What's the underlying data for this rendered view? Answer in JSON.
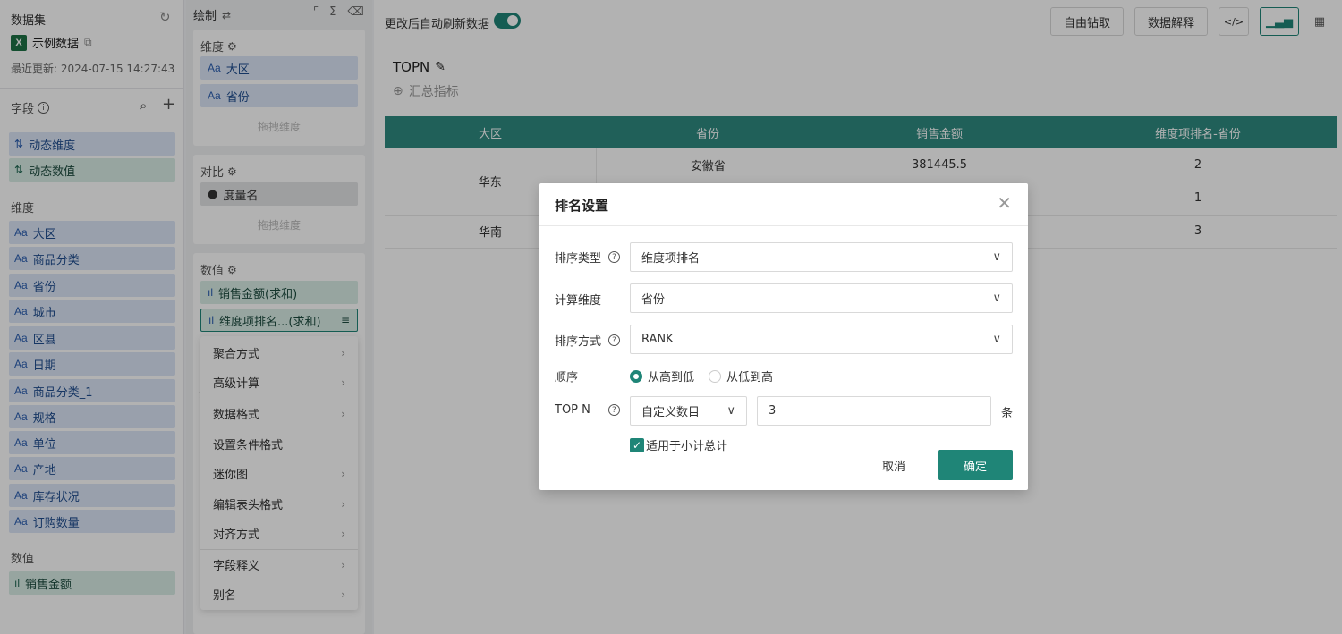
{
  "left": {
    "dataset_title": "数据集",
    "dataset_name": "示例数据",
    "last_update": "最近更新: 2024-07-15 14:27:43",
    "fields_label": "字段",
    "dynamic": [
      "动态维度",
      "动态数值"
    ],
    "dimensions_label": "维度",
    "dimensions": [
      "大区",
      "商品分类",
      "省份",
      "城市",
      "区县",
      "日期",
      "商品分类_1",
      "规格",
      "单位",
      "产地",
      "库存状况",
      "订购数量"
    ],
    "measures_label": "数值",
    "measures": [
      "销售金额"
    ]
  },
  "mid": {
    "draw_label": "绘制",
    "dim_label": "维度",
    "dim_pills": [
      "大区",
      "省份"
    ],
    "dim_hint": "拖拽维度",
    "compare_label": "对比",
    "compare_pill": "度量名",
    "compare_hint": "拖拽维度",
    "value_label": "数值",
    "value_pills": [
      "销售金额(求和)",
      "维度项排名...(求和)"
    ],
    "fen_peek": "分"
  },
  "menu": {
    "items": [
      "聚合方式",
      "高级计算",
      "数据格式",
      "设置条件格式",
      "迷你图",
      "编辑表头格式",
      "对齐方式",
      "字段释义",
      "别名"
    ]
  },
  "main": {
    "auto_refresh": "更改后自动刷新数据",
    "btn_drill": "自由钻取",
    "btn_explain": "数据解释",
    "code_icon": "</>",
    "title": "TOPN",
    "add_metric": "汇总指标",
    "table": {
      "headers": [
        "大区",
        "省份",
        "销售金额",
        "维度项排名-省份"
      ],
      "rows": [
        {
          "region": "华东",
          "province": "安徽省",
          "amount": "381445.5",
          "rank": "2"
        },
        {
          "region": "",
          "province": "",
          "amount": "",
          "rank": "1"
        },
        {
          "region": "华南",
          "province": "",
          "amount": "",
          "rank": "3"
        }
      ]
    }
  },
  "modal": {
    "title": "排名设置",
    "sort_type_label": "排序类型",
    "sort_type_value": "维度项排名",
    "calc_dim_label": "计算维度",
    "calc_dim_value": "省份",
    "sort_method_label": "排序方式",
    "sort_method_value": "RANK",
    "order_label": "顺序",
    "order_desc": "从高到低",
    "order_asc": "从低到高",
    "topn_label": "TOP N",
    "topn_mode": "自定义数目",
    "topn_value": "3",
    "topn_unit": "条",
    "subtotal_label": "适用于小计总计",
    "cancel": "取消",
    "ok": "确定"
  }
}
